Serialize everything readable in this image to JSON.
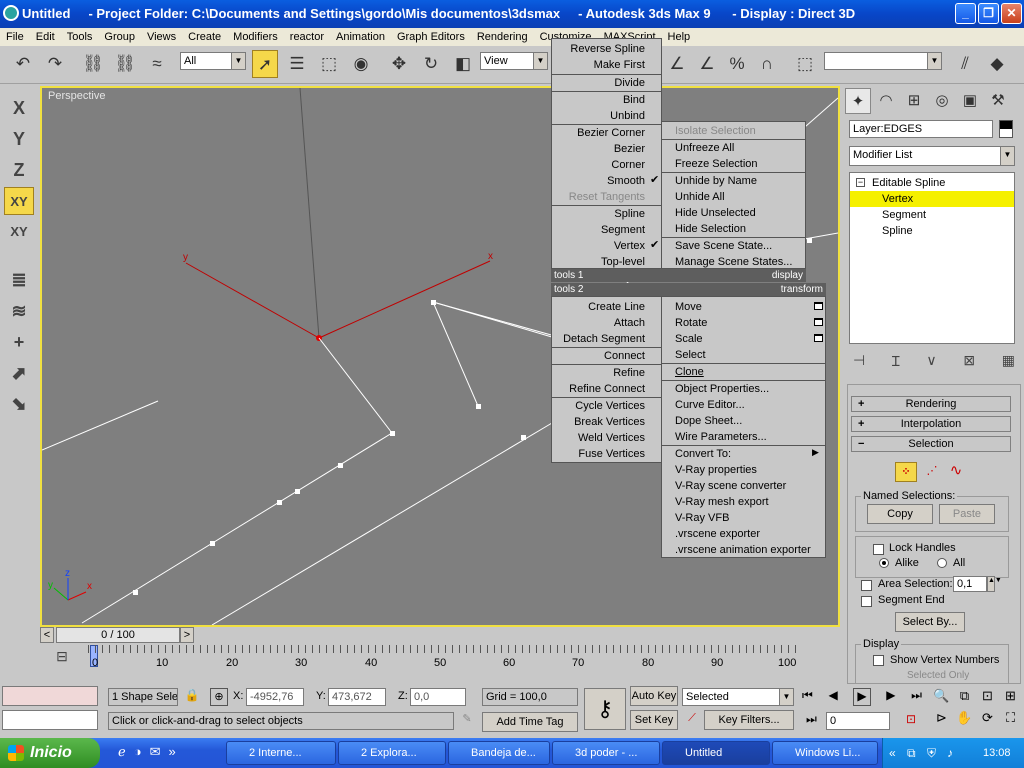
{
  "title_bar": {
    "text": "Untitled     - Project Folder: C:\\Documents and Settings\\gordo\\Mis documentos\\3dsmax     - Autodesk 3ds Max 9      - Display : Direct 3D",
    "minimize": "_",
    "maximize": "❐",
    "close": "✕"
  },
  "menu": [
    "File",
    "Edit",
    "Tools",
    "Group",
    "Views",
    "Create",
    "Modifiers",
    "reactor",
    "Animation",
    "Graph Editors",
    "Rendering",
    "Customize",
    "MAXScript",
    "Help"
  ],
  "toolbar": {
    "selection_filter": "All",
    "ref_coord": "View",
    "named_sel": ""
  },
  "left_toolbar": [
    "X",
    "Y",
    "Z",
    "XY",
    "XY"
  ],
  "viewport": {
    "label": "Perspective",
    "gizmo_x": "x",
    "gizmo_y": "y",
    "axis_x": "x",
    "axis_y": "y",
    "axis_z": "z"
  },
  "quad_menu": {
    "top_left": [
      "Reverse Spline",
      "Make First",
      "Divide",
      "Bind",
      "Unbind",
      "Bezier Corner",
      "Bezier",
      "Corner",
      "Smooth",
      "Reset Tangents",
      "Spline",
      "Segment",
      "Vertex",
      "Top-level"
    ],
    "top_left_checked": [
      "Smooth",
      "Vertex"
    ],
    "top_right": [
      "Isolate Selection",
      "Unfreeze All",
      "Freeze Selection",
      "Unhide by Name",
      "Unhide All",
      "Hide Unselected",
      "Hide Selection",
      "Save Scene State...",
      "Manage Scene States..."
    ],
    "header_tools1": "tools 1",
    "header_display": "display",
    "header_tools2": "tools 2",
    "header_transform": "transform",
    "bottom_left": [
      "Create Line",
      "Attach",
      "Detach Segment",
      "Connect",
      "Refine",
      "Refine Connect",
      "Cycle Vertices",
      "Break Vertices",
      "Weld Vertices",
      "Fuse Vertices"
    ],
    "bottom_right": [
      "Move",
      "Rotate",
      "Scale",
      "Select",
      "Clone",
      "Object Properties...",
      "Curve Editor...",
      "Dope Sheet...",
      "Wire Parameters...",
      "Convert To:",
      "V-Ray properties",
      "V-Ray scene converter",
      "V-Ray mesh export",
      "V-Ray VFB",
      ".vrscene exporter",
      ".vrscene animation exporter"
    ]
  },
  "command_panel": {
    "object_name": "Layer:EDGES",
    "modifier_list": "Modifier List",
    "stack": [
      "Editable Spline",
      "Vertex",
      "Segment",
      "Spline"
    ],
    "rollouts": {
      "rendering": "Rendering",
      "interpolation": "Interpolation",
      "selection": "Selection"
    },
    "named_selections": "Named Selections:",
    "copy": "Copy",
    "paste": "Paste",
    "lock_handles": "Lock Handles",
    "alike": "Alike",
    "all": "All",
    "area_selection": "Area Selection:",
    "area_value": "0,1",
    "segment_end": "Segment End",
    "select_by": "Select By...",
    "display": "Display",
    "show_vertex_numbers": "Show Vertex Numbers",
    "selected_only": "Selected Only"
  },
  "time_slider": {
    "label": "0 / 100",
    "prev": "<",
    "next": ">"
  },
  "ruler_ticks": [
    "0",
    "10",
    "20",
    "30",
    "40",
    "50",
    "60",
    "70",
    "80",
    "90",
    "100"
  ],
  "status": {
    "selection_count": "1 Shape Sele",
    "prompt": "Click or click-and-drag to select objects",
    "x_label": "X:",
    "x": "-4952,76",
    "y_label": "Y:",
    "y": "473,672",
    "z_label": "Z:",
    "z": "0,0",
    "grid": "Grid = 100,0",
    "add_time_tag": "Add Time Tag",
    "auto_key": "Auto Key",
    "set_key": "Set Key",
    "key_mode": "Selected",
    "key_filters": "Key Filters...",
    "frame": "0"
  },
  "taskbar": {
    "start": "Inicio",
    "tasks": [
      "2 Interne...",
      "2 Explora...",
      "Bandeja de...",
      "3d poder - ...",
      "Untitled",
      "Windows Li..."
    ],
    "active_task": "Untitled",
    "clock": "13:08"
  }
}
